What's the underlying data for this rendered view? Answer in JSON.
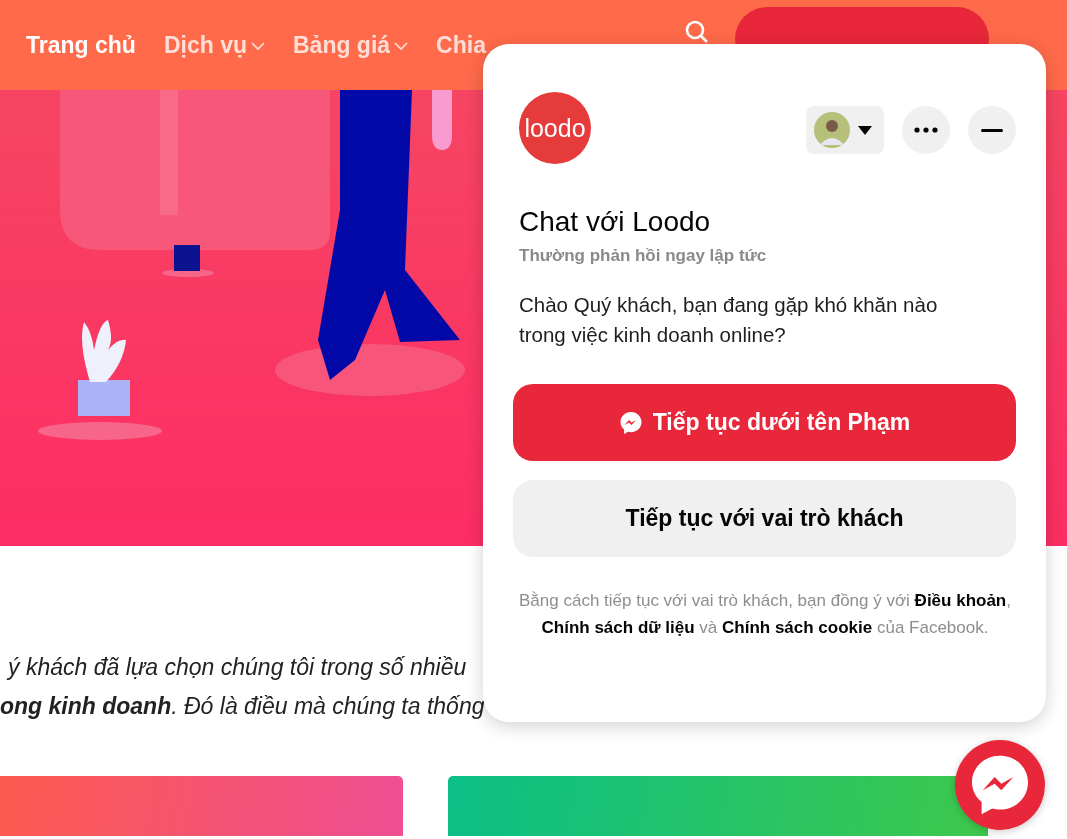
{
  "nav": {
    "items": [
      {
        "label": "Trang chủ",
        "selected": true,
        "has_dropdown": false
      },
      {
        "label": "Dịch vụ",
        "selected": false,
        "has_dropdown": true
      },
      {
        "label": "Bảng giá",
        "selected": false,
        "has_dropdown": true
      },
      {
        "label": "Chia",
        "selected": false
      }
    ]
  },
  "intro_lines": [
    "ý khách đã lựa chọn chúng tôi trong số nhiều",
    "**ong kinh doanh**. Đó là điều mà chúng ta thống"
  ],
  "chat_popup": {
    "logo": "loodo",
    "title": "Chat với Loodo",
    "subtitle": "Thường phản hồi ngay lập tức",
    "message": "Chào Quý khách, bạn đang gặp khó khăn nào trong việc kinh doanh online?",
    "buttons": [
      {
        "label": "Tiếp tục dưới tên Phạm",
        "kind": "primary"
      },
      {
        "label": "Tiếp tục với vai trò khách",
        "kind": "secondary"
      }
    ],
    "footer": "Bằng cách tiếp tục với vai trò khách, bạn đồng ý với **Điều khoản**, **Chính sách dữ liệu** và **Chính sách cookie** của Facebook."
  }
}
